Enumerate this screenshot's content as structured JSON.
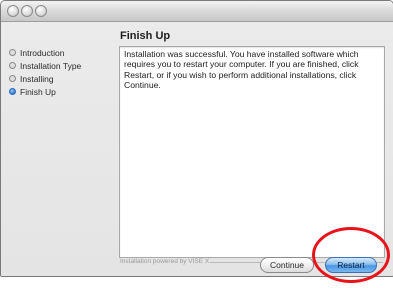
{
  "installer": {
    "pane_title": "Finish Up",
    "steps": [
      {
        "label": "Introduction",
        "active": false
      },
      {
        "label": "Installation Type",
        "active": false
      },
      {
        "label": "Installing",
        "active": false
      },
      {
        "label": "Finish Up",
        "active": true
      }
    ],
    "message": "Installation was successful. You have installed software which requires you to restart your computer. If you are finished, click Restart, or if you wish to perform additional installations, click Continue.",
    "footer_text": "Installation powered by VISE X",
    "buttons": {
      "continue_label": "Continue",
      "restart_label": "Restart"
    }
  },
  "colors": {
    "highlight_ring": "#e8141b",
    "default_button": "#4b97e3",
    "active_step_bullet": "#3d85d9"
  },
  "icons": {
    "window_controls": [
      "close-icon",
      "minimize-icon",
      "zoom-icon"
    ],
    "step_bullet": "circle-bullet-icon"
  }
}
